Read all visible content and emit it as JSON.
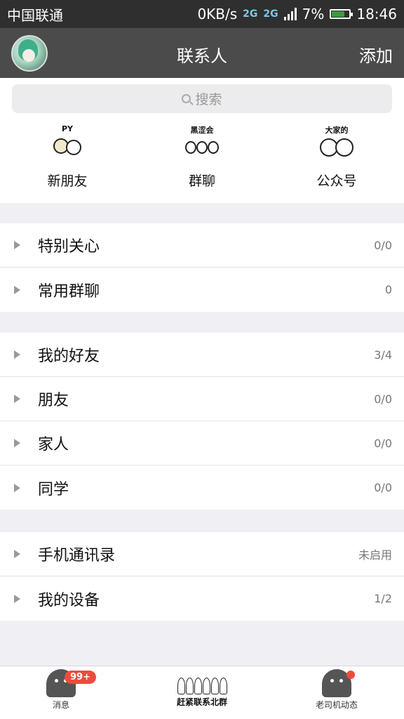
{
  "status_bar": {
    "carrier": "中国联通",
    "speed": "0KB/s",
    "network1": "2G",
    "network2": "2G",
    "battery": "7%",
    "time": "18:46"
  },
  "header": {
    "title": "联系人",
    "add_label": "添加"
  },
  "search": {
    "placeholder": "搜索"
  },
  "quick_entries": [
    {
      "label": "新朋友",
      "icon": "new-friend-icon",
      "sticker_text": "PY"
    },
    {
      "label": "群聊",
      "icon": "group-chat-icon",
      "sticker_text": "黑涩会"
    },
    {
      "label": "公众号",
      "icon": "official-account-icon",
      "sticker_text": "大家的"
    }
  ],
  "groups": [
    {
      "label": "特别关心",
      "count": "0/0"
    },
    {
      "label": "常用群聊",
      "count": "0"
    },
    {
      "label": "我的好友",
      "count": "3/4"
    },
    {
      "label": "朋友",
      "count": "0/0"
    },
    {
      "label": "家人",
      "count": "0/0"
    },
    {
      "label": "同学",
      "count": "0/0"
    },
    {
      "label": "手机通讯录",
      "count": "未启用"
    },
    {
      "label": "我的设备",
      "count": "1/2"
    }
  ],
  "tabbar": {
    "messages": {
      "label": "消息",
      "badge": "99+"
    },
    "center": {
      "label": "赶紧联系北群"
    },
    "feed": {
      "label": "老司机动态"
    }
  },
  "colors": {
    "header_bg": "#4b4b4b",
    "status_bg": "#2f2f2f",
    "badge": "#f04a3c",
    "page_bg": "#efeff4"
  }
}
